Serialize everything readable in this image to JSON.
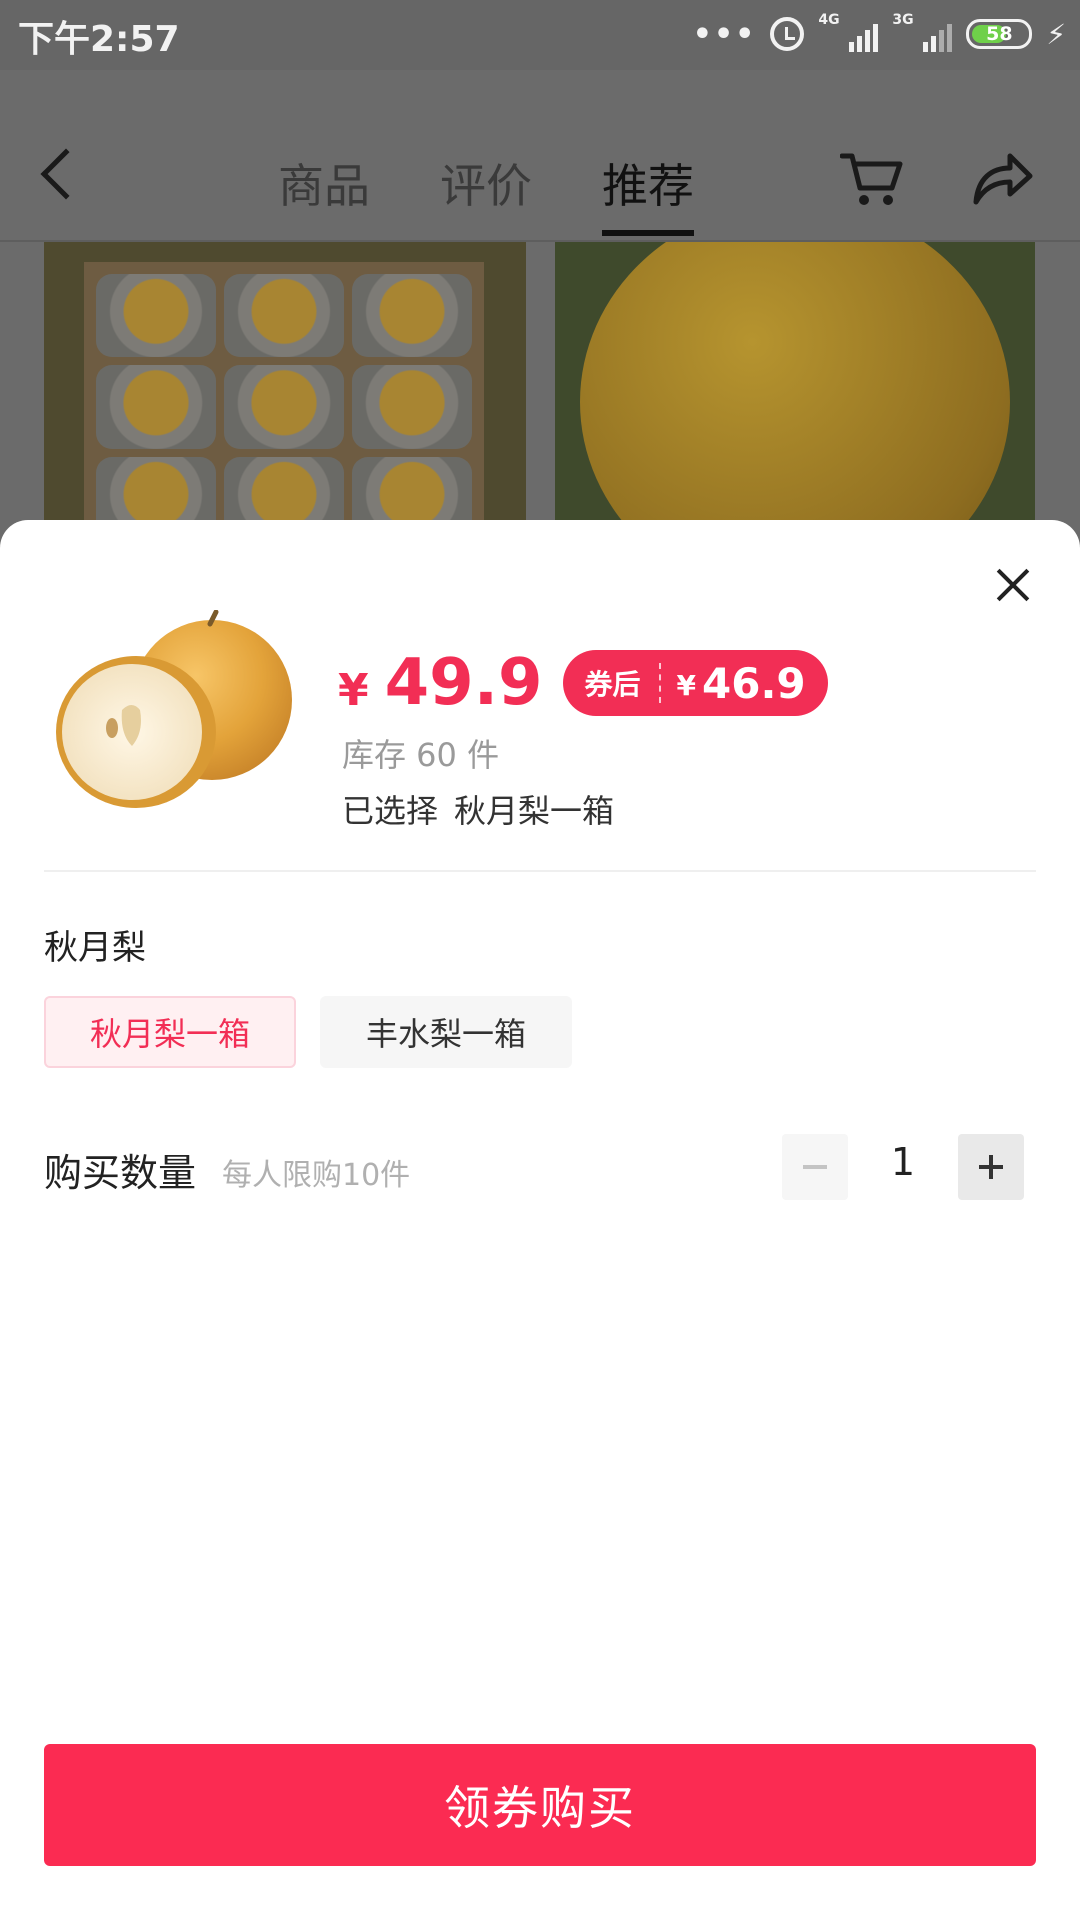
{
  "status_bar": {
    "time": "下午2:57",
    "signal_1": "4G",
    "signal_2": "3G",
    "battery": "58"
  },
  "nav": {
    "tabs": [
      {
        "label": "商品",
        "active": false
      },
      {
        "label": "评价",
        "active": false
      },
      {
        "label": "推荐",
        "active": true
      }
    ],
    "icons": [
      "back-icon",
      "cart-icon",
      "share-icon"
    ]
  },
  "sheet": {
    "price_currency": "¥",
    "price": "49.9",
    "coupon": {
      "label": "券后",
      "currency": "¥",
      "price": "46.9"
    },
    "stock": "库存 60 件",
    "selected_label": "已选择",
    "selected_value": "秋月梨一箱",
    "spec_title": "秋月梨",
    "spec_options": [
      {
        "label": "秋月梨一箱",
        "selected": true
      },
      {
        "label": "丰水梨一箱",
        "selected": false
      }
    ],
    "quantity": {
      "title": "购买数量",
      "limit": "每人限购10件",
      "value": "1"
    },
    "buy_button": "领券购买"
  },
  "colors": {
    "accent": "#f22e55",
    "button": "#fb2b52",
    "overlay": "#6b6b6b"
  }
}
